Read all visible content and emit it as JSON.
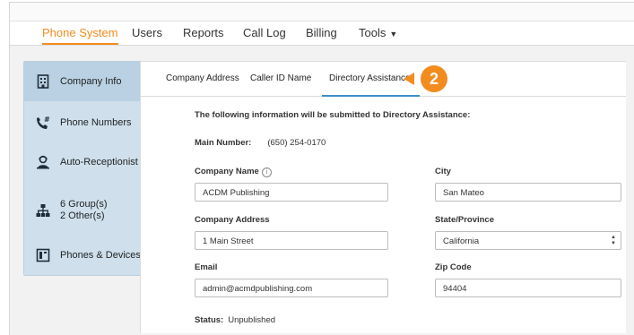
{
  "nav": {
    "items": [
      {
        "label": "Phone System"
      },
      {
        "label": "Users"
      },
      {
        "label": "Reports"
      },
      {
        "label": "Call Log"
      },
      {
        "label": "Billing"
      },
      {
        "label": "Tools"
      }
    ],
    "active_color": "#f28c1f"
  },
  "sidebar": {
    "items": [
      {
        "label": "Company Info",
        "icon": "building-icon"
      },
      {
        "label": "Phone Numbers",
        "icon": "phone-hash-icon"
      },
      {
        "label": "Auto-Receptionist",
        "icon": "receptionist-icon"
      },
      {
        "label": "6 Group(s)",
        "label2": "2 Other(s)",
        "icon": "group-hierarchy-icon"
      },
      {
        "label": "Phones & Devices",
        "icon": "device-icon"
      }
    ]
  },
  "tabs": [
    {
      "label": "Company Address"
    },
    {
      "label": "Caller ID Name"
    },
    {
      "label": "Directory Assistance"
    }
  ],
  "callout": {
    "number": "2",
    "color": "#f28c1f"
  },
  "form": {
    "intro": "The following information will be submitted to Directory Assistance:",
    "main_number_label": "Main Number:",
    "main_number_value": "(650) 254-0170",
    "company_name_label": "Company Name",
    "company_name_value": "ACDM Publishing",
    "company_address_label": "Company Address",
    "company_address_value": "1 Main Street",
    "email_label": "Email",
    "email_value": "admin@acmdpublishing.com",
    "city_label": "City",
    "city_value": "San Mateo",
    "state_label": "State/Province",
    "state_value": "California",
    "zip_label": "Zip Code",
    "zip_value": "94404",
    "status_label": "Status:",
    "status_value": "Unpublished"
  }
}
